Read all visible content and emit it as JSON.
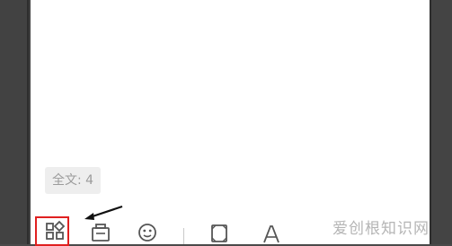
{
  "editor": {
    "word_count_label": "全文: 4"
  },
  "toolbar": {
    "buttons": [
      {
        "id": "grid",
        "icon": "grid-apps-icon",
        "highlighted": true
      },
      {
        "id": "device",
        "icon": "printer-icon"
      },
      {
        "id": "emoji",
        "icon": "emoji-icon"
      },
      {
        "id": "frame",
        "icon": "frame-icon"
      },
      {
        "id": "text",
        "icon": "text-format-icon"
      }
    ],
    "highlight_color": "#e02020"
  },
  "annotation": {
    "arrow_color": "#111111"
  },
  "watermark": {
    "text": "爱创根知识网"
  },
  "colors": {
    "background": "#4a4a4a",
    "editor_background": "#ffffff",
    "muted_text": "#9b9b9b",
    "icon": "#555555"
  }
}
